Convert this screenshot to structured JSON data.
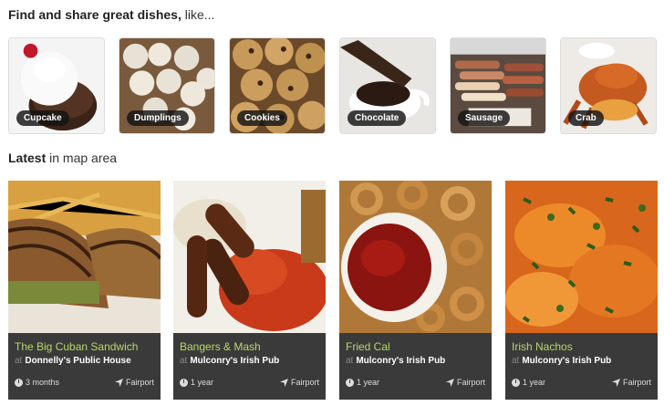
{
  "find_heading": {
    "bold": "Find and share great dishes,",
    "light": " like..."
  },
  "dishes": [
    {
      "label": "Cupcake"
    },
    {
      "label": "Dumplings"
    },
    {
      "label": "Cookies"
    },
    {
      "label": "Chocolate"
    },
    {
      "label": "Sausage"
    },
    {
      "label": "Crab"
    }
  ],
  "latest_heading": {
    "bold": "Latest",
    "light": " in map area"
  },
  "cards": [
    {
      "dish": "The Big Cuban Sandwich",
      "at": "at",
      "restaurant": "Donnelly's Public House",
      "age": "3 months",
      "location": "Fairport"
    },
    {
      "dish": "Bangers & Mash",
      "at": "at",
      "restaurant": "Mulconry's Irish Pub",
      "age": "1 year",
      "location": "Fairport"
    },
    {
      "dish": "Fried Cal",
      "at": "at",
      "restaurant": "Mulconry's Irish Pub",
      "age": "1 year",
      "location": "Fairport"
    },
    {
      "dish": "Irish Nachos",
      "at": "at",
      "restaurant": "Mulconry's Irish Pub",
      "age": "1 year",
      "location": "Fairport"
    }
  ],
  "colors": {
    "dish_name": "#b6d96a",
    "card_bg": "#3a3a3a"
  },
  "icons": {
    "age": "clock-icon",
    "location": "location-arrow-icon"
  }
}
